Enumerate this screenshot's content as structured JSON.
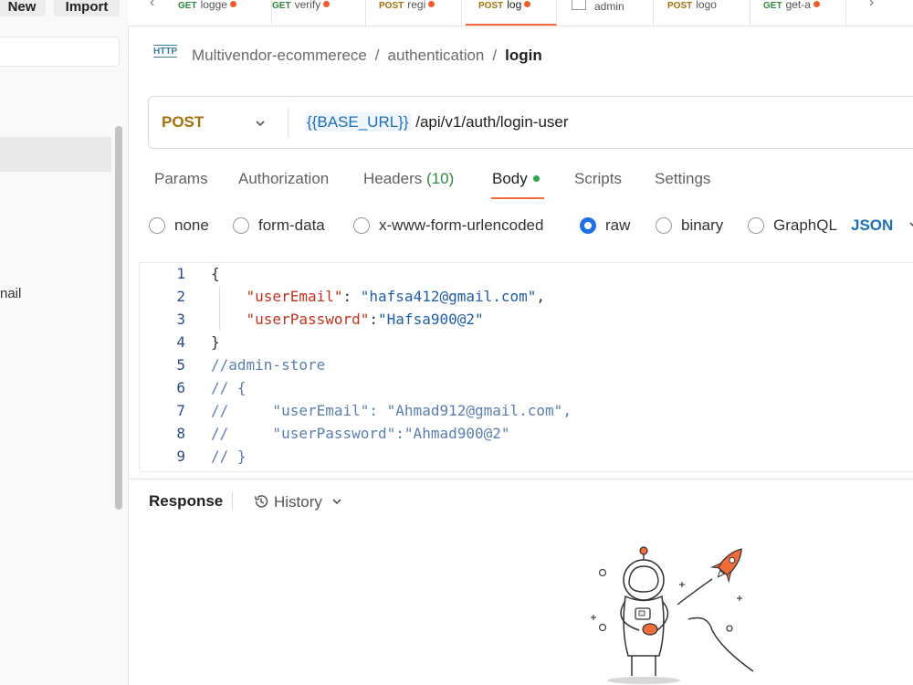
{
  "sidebar": {
    "new_label": "New",
    "import_label": "Import",
    "partial_item_text": "nail"
  },
  "tabs": [
    {
      "method": "GET",
      "name": "logge",
      "method_color": "#2f8a3c",
      "dirty": true
    },
    {
      "method": "GET",
      "name": "verify",
      "method_color": "#2f8a3c",
      "dirty": true
    },
    {
      "method": "POST",
      "name": "regi",
      "method_color": "#a6700c",
      "dirty": true
    },
    {
      "method": "POST",
      "name": "log",
      "method_color": "#a6700c",
      "dirty": true,
      "active": true
    },
    {
      "method": "",
      "name": "admin",
      "method_color": "#888888",
      "dirty": false
    },
    {
      "method": "POST",
      "name": "logo",
      "method_color": "#a6700c",
      "dirty": false
    },
    {
      "method": "GET",
      "name": "get-a",
      "method_color": "#2f8a3c",
      "dirty": true
    }
  ],
  "breadcrumb": {
    "icon_text": "HTTP",
    "items": [
      "Multivendor-ecommerece",
      "authentication"
    ],
    "current": "login"
  },
  "request": {
    "method": "POST",
    "url_variable": "{{BASE_URL}}",
    "url_path": " /api/v1/auth/login-user"
  },
  "request_tabs": {
    "params": "Params",
    "authorization": "Authorization",
    "headers": "Headers",
    "headers_count": "(10)",
    "body": "Body",
    "scripts": "Scripts",
    "settings": "Settings"
  },
  "body_types": {
    "none": "none",
    "form_data": "form-data",
    "urlencoded": "x-www-form-urlencoded",
    "raw": "raw",
    "binary": "binary",
    "graphql": "GraphQL",
    "selected": "raw",
    "format": "JSON"
  },
  "code": {
    "line_numbers": [
      "1",
      "2",
      "3",
      "4",
      "5",
      "6",
      "7",
      "8",
      "9"
    ],
    "l1": "{",
    "l2_key": "\"userEmail\"",
    "l2_colon": ": ",
    "l2_val": "\"hafsa412@gmail.com\"",
    "l2_end": ",",
    "l3_key": "\"userPassword\"",
    "l3_colon": ":",
    "l3_val": "\"Hafsa900@2\"",
    "l4": "}",
    "l5": "//admin-store",
    "l6": "// {",
    "l7": "//     \"userEmail\": \"Ahmad912@gmail.com\",",
    "l8": "//     \"userPassword\":\"Ahmad900@2\"",
    "l9": "// }"
  },
  "response": {
    "title": "Response",
    "history": "History"
  },
  "colors": {
    "accent": "#f26b3a",
    "link_blue": "#1f6fb5",
    "post_method": "#a6700c"
  }
}
